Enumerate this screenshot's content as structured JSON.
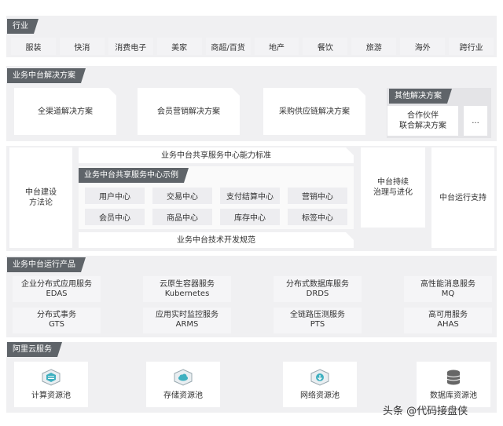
{
  "industry": {
    "tag": "行业",
    "items": [
      "服装",
      "快消",
      "消费电子",
      "美家",
      "商超/百货",
      "地产",
      "餐饮",
      "旅游",
      "海外",
      "跨行业"
    ]
  },
  "solutions": {
    "tag": "业务中台解决方案",
    "items": [
      "全渠道解决方案",
      "会员营销解决方案",
      "采购供应链解决方案"
    ],
    "other": {
      "tag": "其他解决方案",
      "partner_line1": "合作伙伴",
      "partner_line2": "联合解决方案",
      "more": "..."
    }
  },
  "middle": {
    "methodology_line1": "中台建设",
    "methodology_line2": "方法论",
    "standard": "业务中台共享服务中心能力标准",
    "centers_tag": "业务中台共享服务中心示例",
    "centers": [
      "用户中心",
      "交易中心",
      "支付结算中心",
      "营销中心",
      "会员中心",
      "商品中心",
      "库存中心",
      "标签中心"
    ],
    "tech_spec": "业务中台技术开发规范",
    "governance_line1": "中台持续",
    "governance_line2": "治理与进化",
    "ops_support": "中台运行支持"
  },
  "products": {
    "tag": "业务中台运行产品",
    "items": [
      {
        "name": "企业分布式应用服务",
        "code": "EDAS"
      },
      {
        "name": "云原生容器服务",
        "code": "Kubernetes"
      },
      {
        "name": "分布式数据库服务",
        "code": "DRDS"
      },
      {
        "name": "高性能消息服务",
        "code": "MQ"
      },
      {
        "name": "分布式事务",
        "code": "GTS"
      },
      {
        "name": "应用实时监控服务",
        "code": "ARMS"
      },
      {
        "name": "全链路压测服务",
        "code": "PTS"
      },
      {
        "name": "高可用服务",
        "code": "AHAS"
      }
    ]
  },
  "cloud": {
    "tag": "阿里云服务",
    "pools": [
      {
        "label": "计算资源池",
        "icon": "compute-cube-icon"
      },
      {
        "label": "存储资源池",
        "icon": "storage-cloud-icon"
      },
      {
        "label": "网络资源池",
        "icon": "network-cloud-icon"
      },
      {
        "label": "数据库资源池",
        "icon": "database-icon"
      }
    ]
  },
  "watermark": "头条 @代码接盘侠",
  "colors": {
    "tag_bg": "#5f6469",
    "band_bg": "#f0f0f2",
    "icon_teal": "#3fb0c0",
    "icon_gray": "#666666"
  }
}
